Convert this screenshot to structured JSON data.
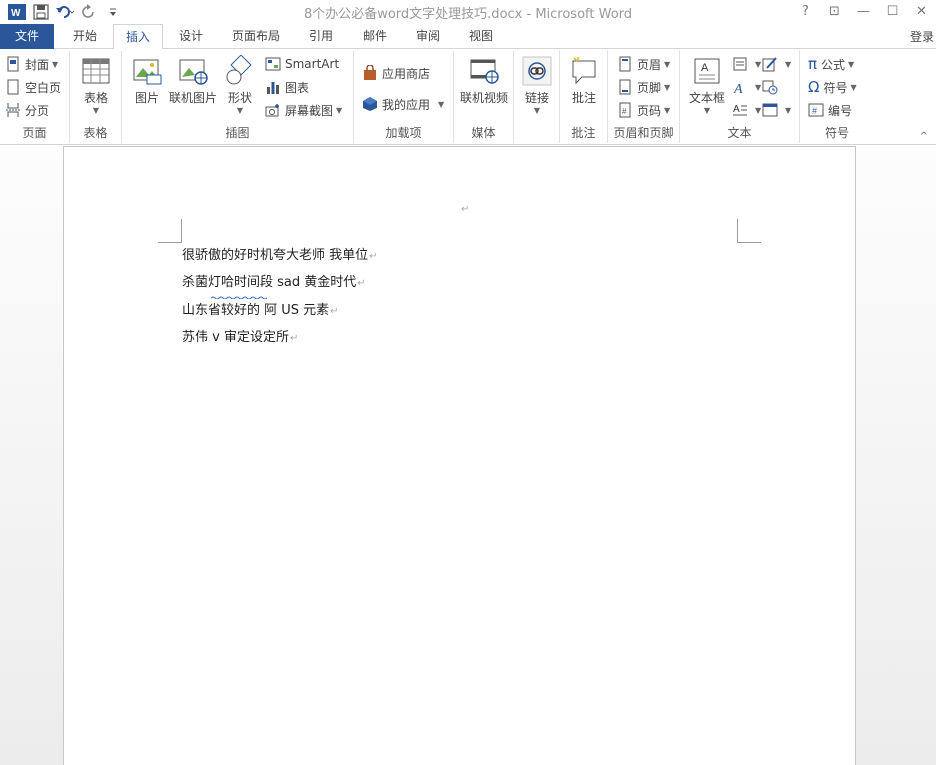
{
  "title": "8个办公必备word文字处理技巧.docx - Microsoft Word",
  "window": {
    "help": "?",
    "ribbon_display": "⊡",
    "minimize": "—",
    "maximize": "☐",
    "close": "✕"
  },
  "tabs": [
    {
      "label": "文件"
    },
    {
      "label": "开始"
    },
    {
      "label": "插入"
    },
    {
      "label": "设计"
    },
    {
      "label": "页面布局"
    },
    {
      "label": "引用"
    },
    {
      "label": "邮件"
    },
    {
      "label": "审阅"
    },
    {
      "label": "视图"
    }
  ],
  "login": "登录",
  "ribbon": {
    "page_group": {
      "label": "页面",
      "cover": "封面",
      "blank": "空白页",
      "break": "分页"
    },
    "table_group": {
      "label": "表格",
      "table": "表格"
    },
    "illustrations": {
      "label": "插图",
      "picture": "图片",
      "online_picture": "联机图片",
      "shapes": "形状",
      "smartart": "SmartArt",
      "chart": "图表",
      "screenshot": "屏幕截图"
    },
    "addins": {
      "label": "加载项",
      "store": "应用商店",
      "my_apps": "我的应用"
    },
    "media": {
      "label": "媒体",
      "online_video": "联机视频"
    },
    "links": {
      "label": "",
      "link": "链接"
    },
    "comments": {
      "label": "批注",
      "comment": "批注"
    },
    "header_footer": {
      "label": "页眉和页脚",
      "header": "页眉",
      "footer": "页脚",
      "page_number": "页码"
    },
    "text": {
      "label": "文本",
      "textbox": "文本框"
    },
    "symbols": {
      "label": "符号",
      "equation": "公式",
      "symbol": "符号",
      "number": "编号"
    }
  },
  "document": {
    "lines": [
      "很骄傲的好时机夸大老师   我单位",
      "杀菌灯哈时间段    sad 黄金时代",
      "山东省较好的    阿 US 元素",
      "苏伟  v 审定设定所"
    ],
    "paragraph_mark": "↵"
  }
}
